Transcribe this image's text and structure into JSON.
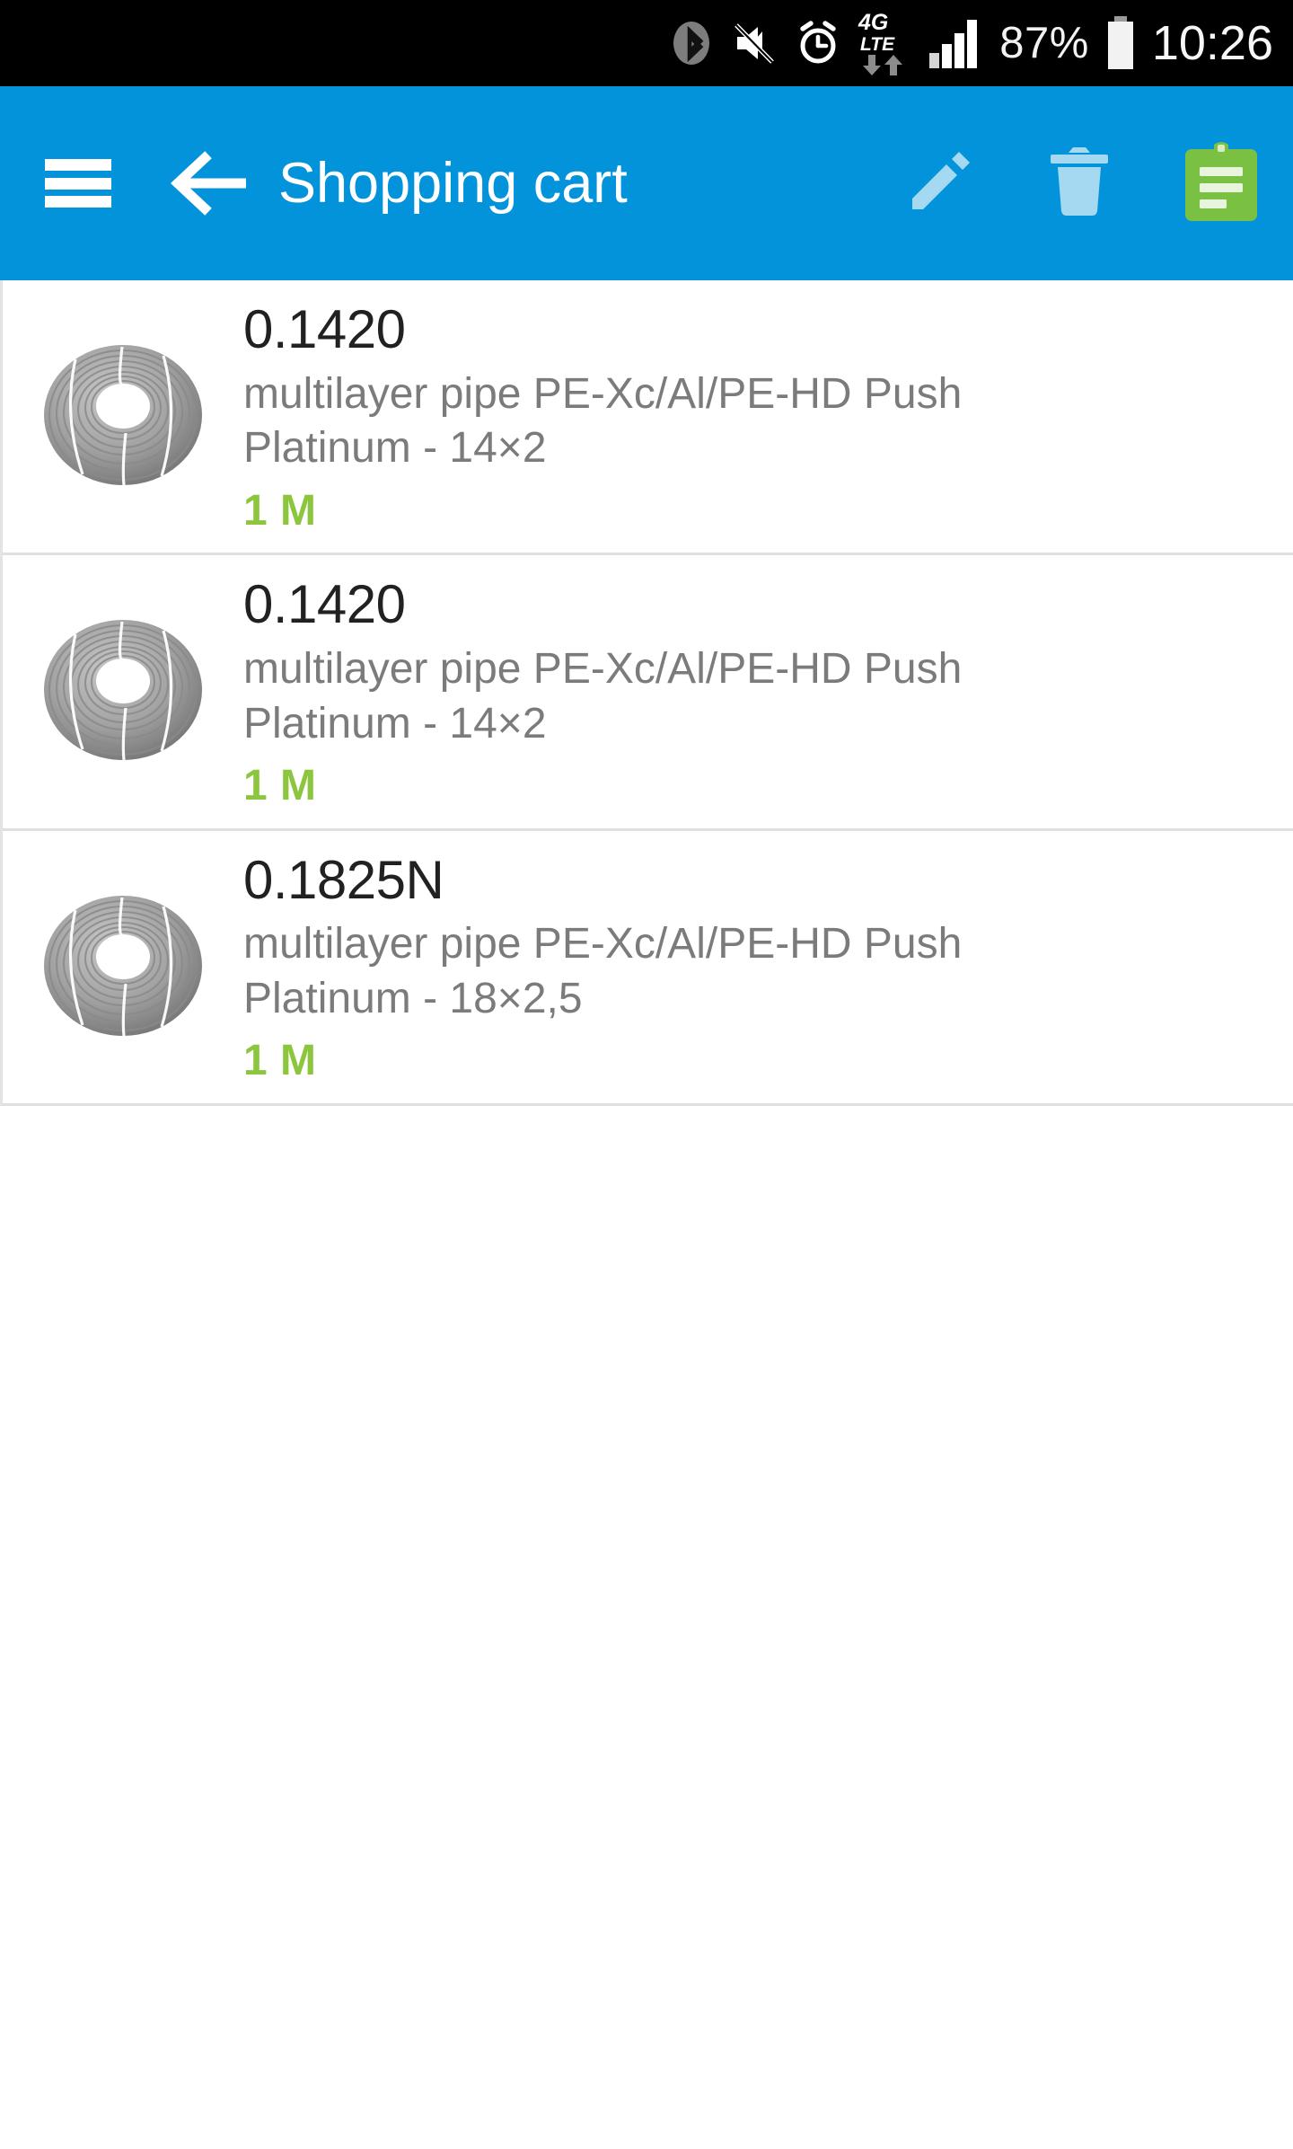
{
  "status_bar": {
    "icons": [
      "bluetooth-icon",
      "mute-icon",
      "alarm-icon",
      "4g-lte-icon",
      "signal-bars-icon",
      "battery-icon"
    ],
    "network_label_top": "4G",
    "network_label_bottom": "LTE",
    "battery_percent": "87%",
    "clock": "10:26"
  },
  "app_bar": {
    "title": "Shopping cart",
    "menu_icon": "hamburger-menu-icon",
    "back_icon": "back-arrow-icon",
    "actions": [
      {
        "name": "edit-button",
        "icon": "pencil-icon",
        "color": "#a5d9f2"
      },
      {
        "name": "delete-button",
        "icon": "trash-icon",
        "color": "#a5d9f2"
      },
      {
        "name": "order-button",
        "icon": "clipboard-icon",
        "color": "#7ac043"
      }
    ]
  },
  "colors": {
    "app_bar_blue": "#0393db",
    "accent_green": "#8cc63f",
    "clipboard_green": "#7ac043",
    "icon_light_blue": "#a5d9f2",
    "divider_gray": "#e0e0e0",
    "code_text": "#212121",
    "desc_text": "#7b7b7b"
  },
  "cart": {
    "items": [
      {
        "code": "0.1420",
        "description": "multilayer pipe PE-Xc/Al/PE-HD Push Platinum - 14×2",
        "quantity": "1 M",
        "thumbnail": "pipe-coil-image"
      },
      {
        "code": "0.1420",
        "description": "multilayer pipe PE-Xc/Al/PE-HD Push Platinum - 14×2",
        "quantity": "1 M",
        "thumbnail": "pipe-coil-image"
      },
      {
        "code": "0.1825N",
        "description": "multilayer pipe PE-Xc/Al/PE-HD Push Platinum - 18×2,5",
        "quantity": "1 M",
        "thumbnail": "pipe-coil-image"
      }
    ]
  }
}
